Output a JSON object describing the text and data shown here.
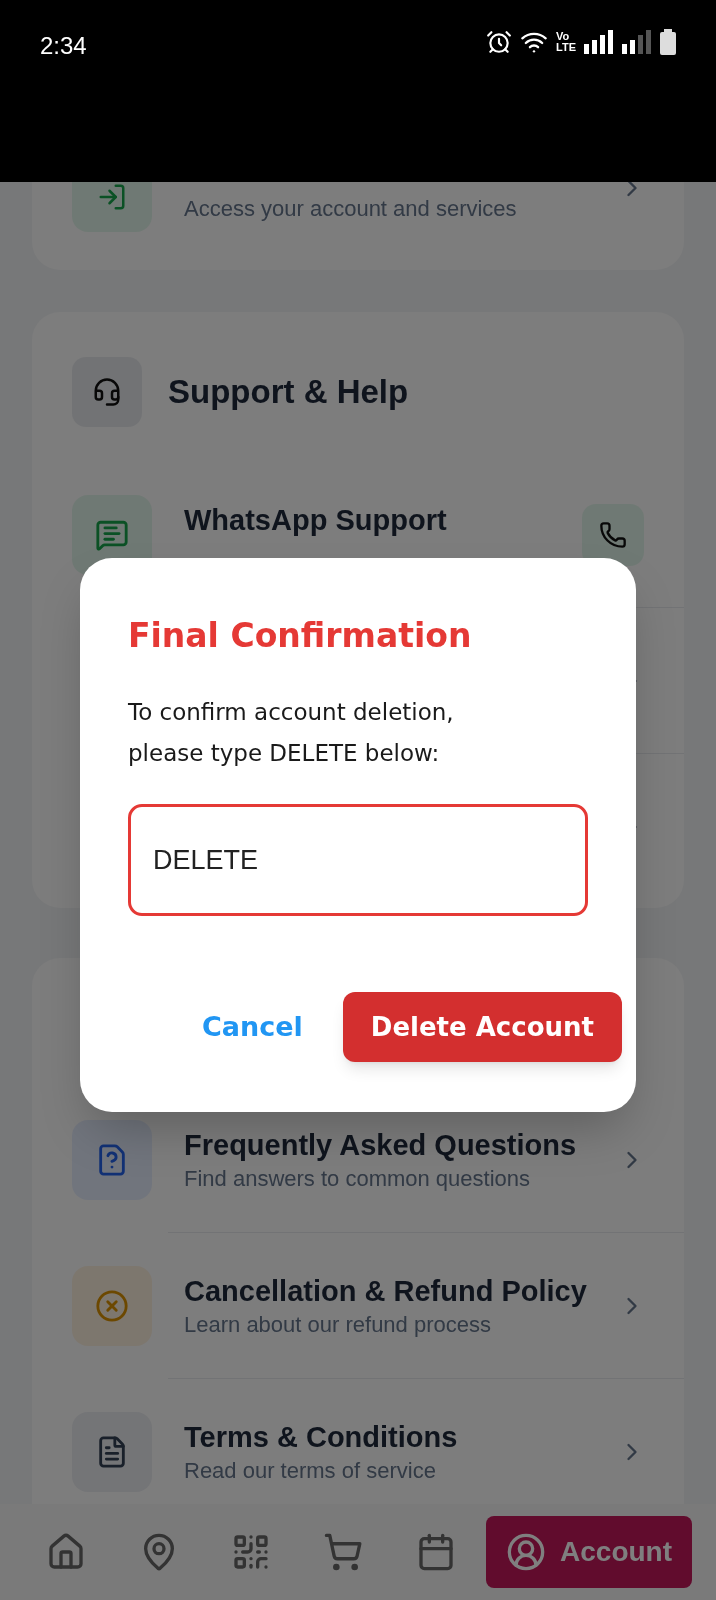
{
  "status_bar": {
    "time": "2:34",
    "network_top": "Vo",
    "network_bottom": "LTE"
  },
  "sign_in": {
    "subtitle": "Access your account and services"
  },
  "support": {
    "title": "Support & Help",
    "rows": [
      {
        "title": "WhatsApp Support"
      }
    ]
  },
  "info_rows": [
    {
      "title": "Frequently Asked Questions",
      "subtitle": "Find answers to common questions"
    },
    {
      "title": "Cancellation & Refund Policy",
      "subtitle": "Learn about our refund process"
    },
    {
      "title": "Terms & Conditions",
      "subtitle": "Read our terms of service"
    }
  ],
  "bottom_nav": [
    {
      "selected": false
    },
    {
      "selected": false
    },
    {
      "selected": false
    },
    {
      "selected": false
    },
    {
      "selected": false
    },
    {
      "label": "Account",
      "selected": true
    }
  ],
  "dialog": {
    "title": "Final Confirmation",
    "message": "To confirm account deletion, please type DELETE below:",
    "input_value": "DELETE",
    "buttons": [
      {
        "label": "Cancel",
        "kind": "text"
      },
      {
        "label": "Delete Account",
        "kind": "filled"
      }
    ]
  }
}
